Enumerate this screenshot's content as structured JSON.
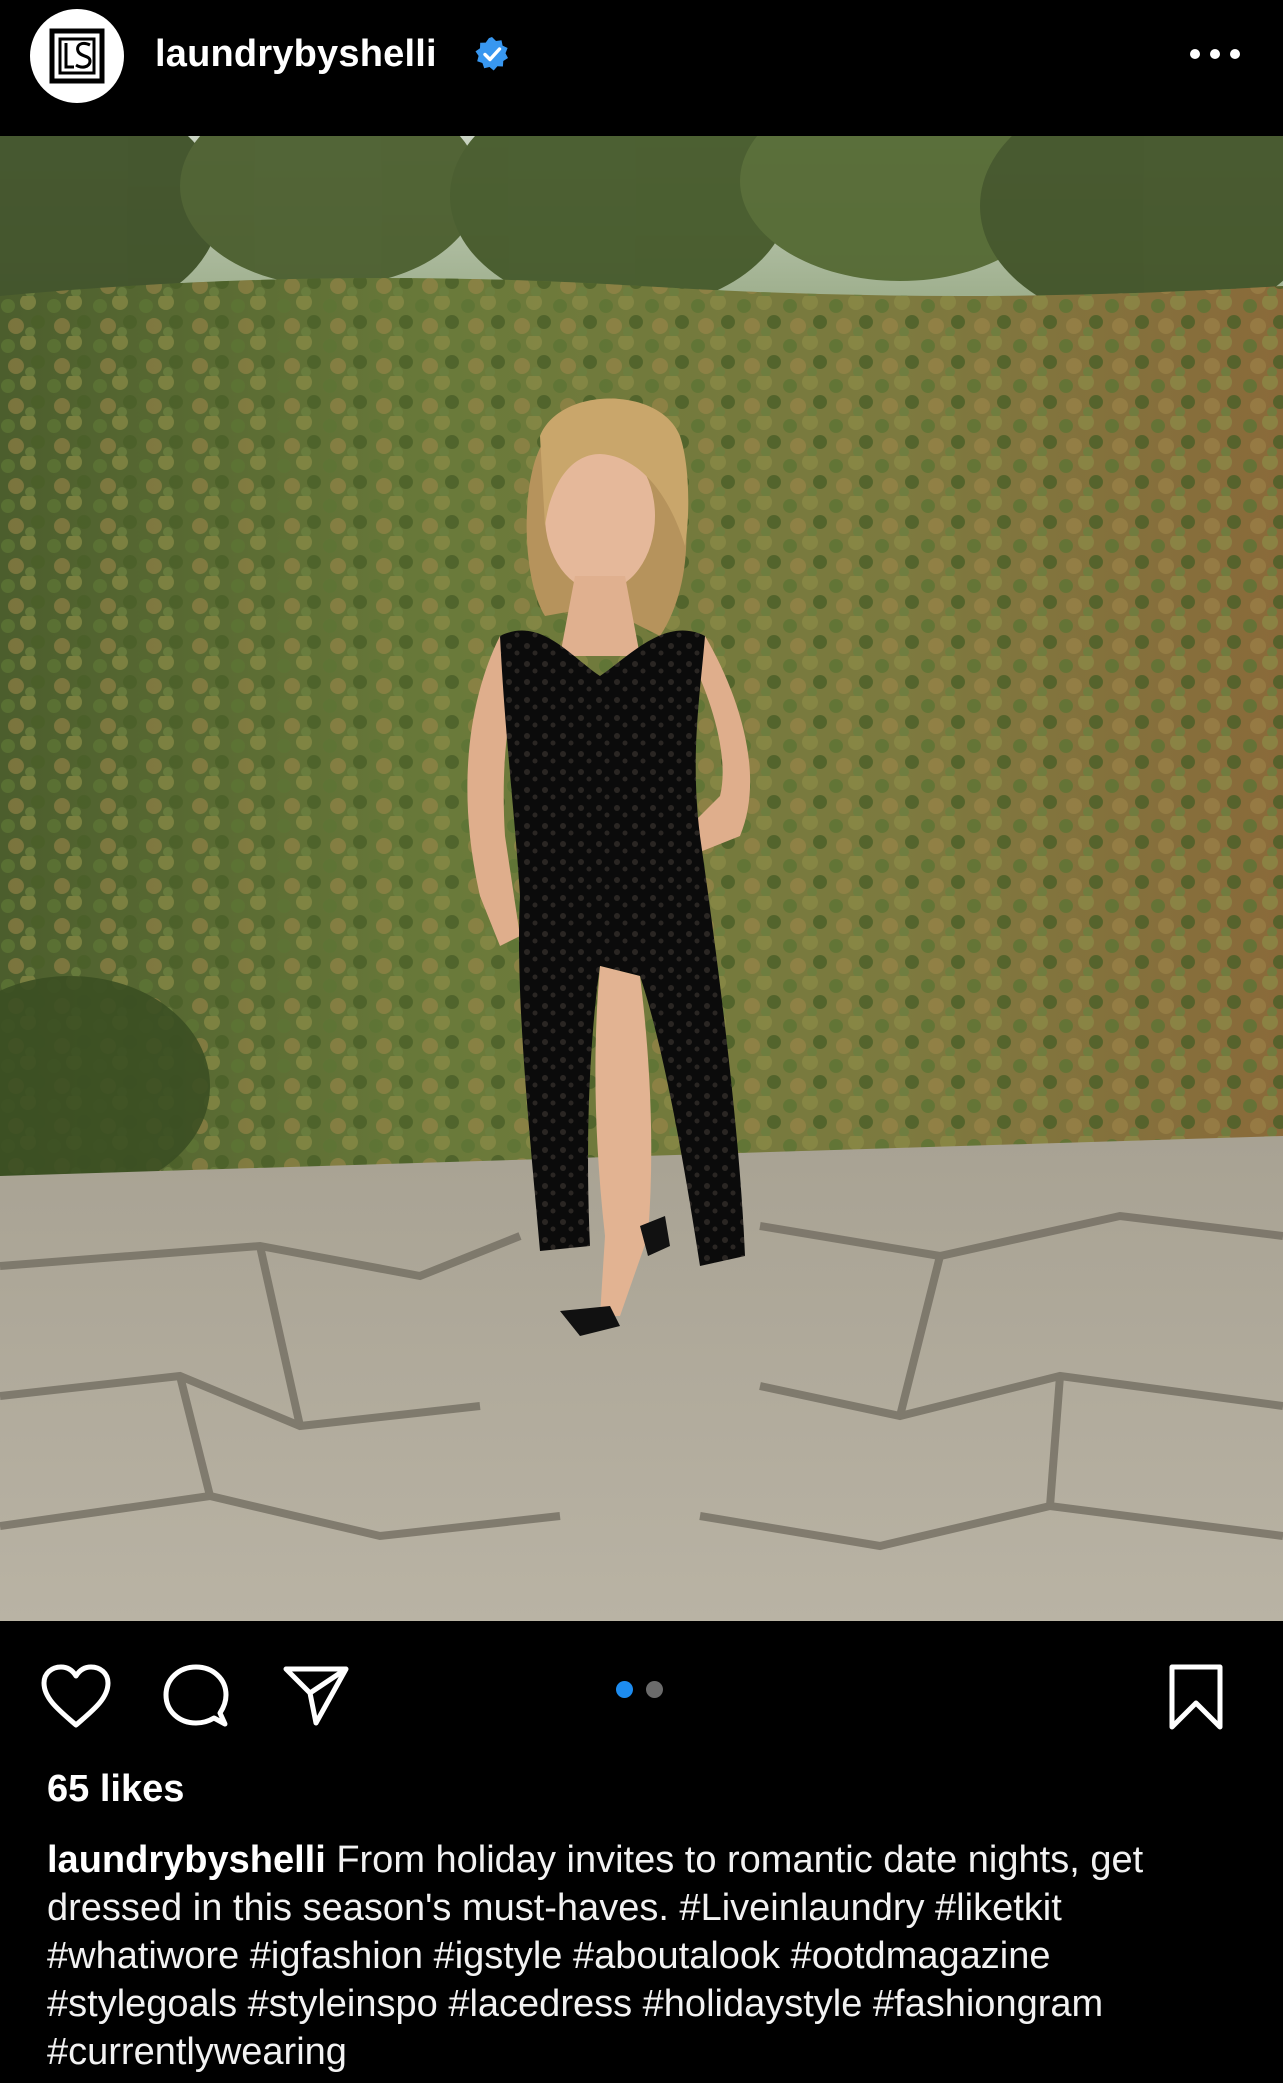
{
  "header": {
    "username": "laundrybyshelli",
    "verified": true,
    "avatar_icon": "brand-logo-ls",
    "more_icon": "more-horizontal-icon"
  },
  "post": {
    "image_alt": "Woman in black lace dress standing in front of ivy wall",
    "carousel": {
      "count": 2,
      "active_index": 0,
      "active_color": "#1d8cf0",
      "inactive_color": "#6b6b6b"
    }
  },
  "actions": {
    "like_icon": "heart-icon",
    "comment_icon": "comment-bubble-icon",
    "share_icon": "paper-plane-icon",
    "save_icon": "bookmark-icon"
  },
  "likes": "65 likes",
  "caption": {
    "username": "laundrybyshelli",
    "text": "From holiday invites to romantic date nights, get dressed in this season's must-haves. #Liveinlaundry #liketkit #whatiwore #igfashion #igstyle #aboutalook #ootdmagazine #stylegoals #styleinspo #lacedress #holidaystyle #fashiongram #currentlywearing"
  },
  "colors": {
    "background": "#000000",
    "text": "#ffffff",
    "verified_badge": "#3897f0"
  }
}
